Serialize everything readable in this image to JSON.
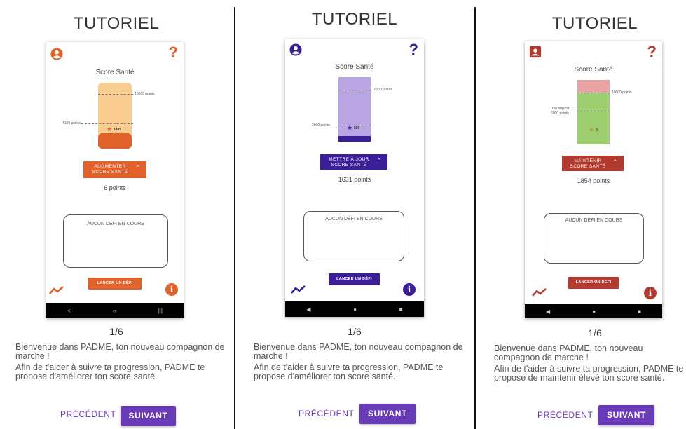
{
  "colors": {
    "orange": "#e0622a",
    "purple": "#3a1f98",
    "red": "#b23a2e",
    "accent": "#6a3bb8"
  },
  "panels": [
    {
      "title": "TUTORIEL",
      "profile_icon": "person-circle-icon",
      "help": "?",
      "score_title": "Score Santé",
      "target_label": "10000 points",
      "current_label": "4100 points",
      "star_value": "1495",
      "action_button": {
        "line1": "AUGMENTER",
        "line2": "SCORE SANTÉ",
        "icon": "chevron-double-up-icon"
      },
      "points": "6 points",
      "defi_status": "AUCUN DÉFI EN COURS",
      "defi_button": "LANCER UN DÉFI",
      "nav": [
        "<",
        "○",
        "|||"
      ],
      "pager": "1/6",
      "desc1": "Bienvenue dans PADME, ton nouveau compagnon de marche !",
      "desc2": "Afin de t'aider à suivre ta progression, PADME te propose d'améliorer ton score santé.",
      "prev": "PRÉCÉDENT",
      "next": "SUIVANT"
    },
    {
      "title": "TUTORIEL",
      "profile_icon": "person-circle-icon",
      "help": "?",
      "score_title": "Score Santé",
      "target_label": "10000 points",
      "current_label": "2600 points",
      "star_value": "500",
      "action_button": {
        "line1": "METTRE À JOUR",
        "line2": "SCORE SANTÉ",
        "icon": "chevron-double-up-icon"
      },
      "points": "1631 points",
      "defi_status": "AUCUN DÉFI EN COURS",
      "defi_button": "LANCER UN DÉFI",
      "nav": [
        "◀",
        "●",
        "■"
      ],
      "pager": "1/6",
      "desc1": "Bienvenue dans PADME, ton nouveau compagnon de marche !",
      "desc2": "Afin de t'aider à suivre ta progression, PADME te propose d'améliorer ton score santé.",
      "prev": "PRÉCÉDENT",
      "next": "SUIVANT"
    },
    {
      "title": "TUTORIEL",
      "profile_icon": "person-badge-icon",
      "help": "?",
      "score_title": "Score Santé",
      "target_label": "10000 points",
      "goal_label_1": "Ton objectif",
      "goal_label_2": "5000 points",
      "star_value": "0",
      "action_button": {
        "line1": "MAINTENIR",
        "line2": "SCORE SANTÉ",
        "icon": "chevron-double-up-icon"
      },
      "points": "1854 points",
      "defi_status": "AUCUN DÉFI EN COURS",
      "defi_button": "LANCER UN DÉFI",
      "nav": [
        "◀",
        "●",
        "■"
      ],
      "pager": "1/6",
      "desc1": "Bienvenue dans PADME, ton nouveau compagnon de marche !",
      "desc2": "Afin de t'aider à suivre ta progression, PADME te propose de maintenir élevé ton score santé.",
      "prev": "PRÉCÉDENT",
      "next": "SUIVANT"
    }
  ]
}
